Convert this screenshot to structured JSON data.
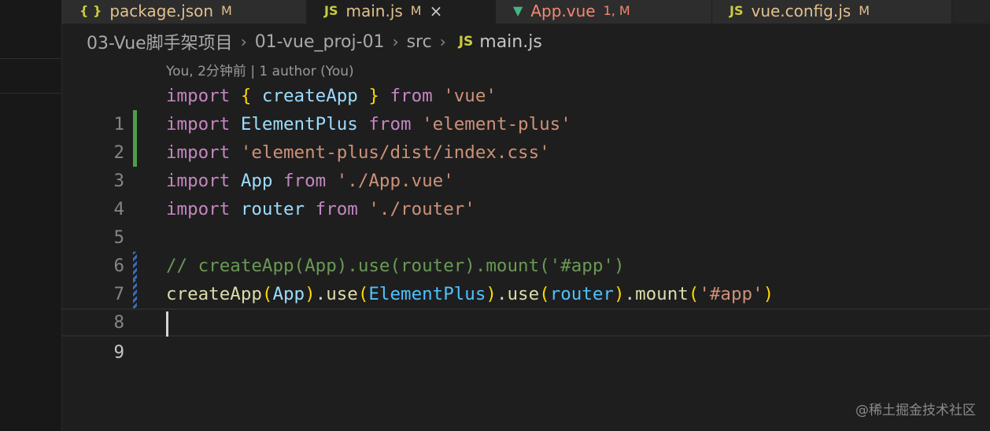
{
  "tabs": [
    {
      "icon": "{ }",
      "name": "package.json",
      "status": "M",
      "icon_color": "#cbcb41",
      "name_color": "#e2c08d",
      "active": false
    },
    {
      "icon": "JS",
      "name": "main.js",
      "status": "M",
      "icon_color": "#cbcb41",
      "name_color": "#e2c08d",
      "active": true,
      "close": "×"
    },
    {
      "icon": "▼",
      "name": "App.vue",
      "status": "1, M",
      "icon_color": "#41b883",
      "name_color": "#f48771",
      "active": false
    },
    {
      "icon": "JS",
      "name": "vue.config.js",
      "status": "M",
      "icon_color": "#cbcb41",
      "name_color": "#e2c08d",
      "active": false
    }
  ],
  "breadcrumb": {
    "segments": [
      "03-Vue脚手架项目",
      "01-vue_proj-01",
      "src"
    ],
    "separator": "›",
    "file_icon": "JS",
    "file": "main.js"
  },
  "codelens": "You, 2分钟前 | 1 author (You)",
  "editor": {
    "line_numbers": [
      "1",
      "2",
      "3",
      "4",
      "5",
      "6",
      "7",
      "8",
      "9"
    ],
    "current_line": "9"
  },
  "code": {
    "l1": {
      "import": "import",
      "open": "{",
      "name": "createApp",
      "close": "}",
      "from": "from",
      "src": "'vue'"
    },
    "l2": {
      "import": "import",
      "name": "ElementPlus",
      "from": "from",
      "src": "'element-plus'"
    },
    "l3": {
      "import": "import",
      "src": "'element-plus/dist/index.css'"
    },
    "l4": {
      "import": "import",
      "name": "App",
      "from": "from",
      "src": "'./App.vue'"
    },
    "l5": {
      "import": "import",
      "name": "router",
      "from": "from",
      "src": "'./router'"
    },
    "l7": {
      "comment": "// createApp(App).use(router).mount('#app')"
    },
    "l8": {
      "fn1": "createApp",
      "p1": "(",
      "a1": "App",
      "p2": ")",
      "dot1": ".",
      "fn2": "use",
      "p3": "(",
      "a2": "ElementPlus",
      "p4": ")",
      "dot2": ".",
      "fn3": "use",
      "p5": "(",
      "a3": "router",
      "p6": ")",
      "dot3": ".",
      "fn4": "mount",
      "p7": "(",
      "s": "'#app'",
      "p8": ")"
    }
  },
  "watermark": "@稀土掘金技术社区"
}
